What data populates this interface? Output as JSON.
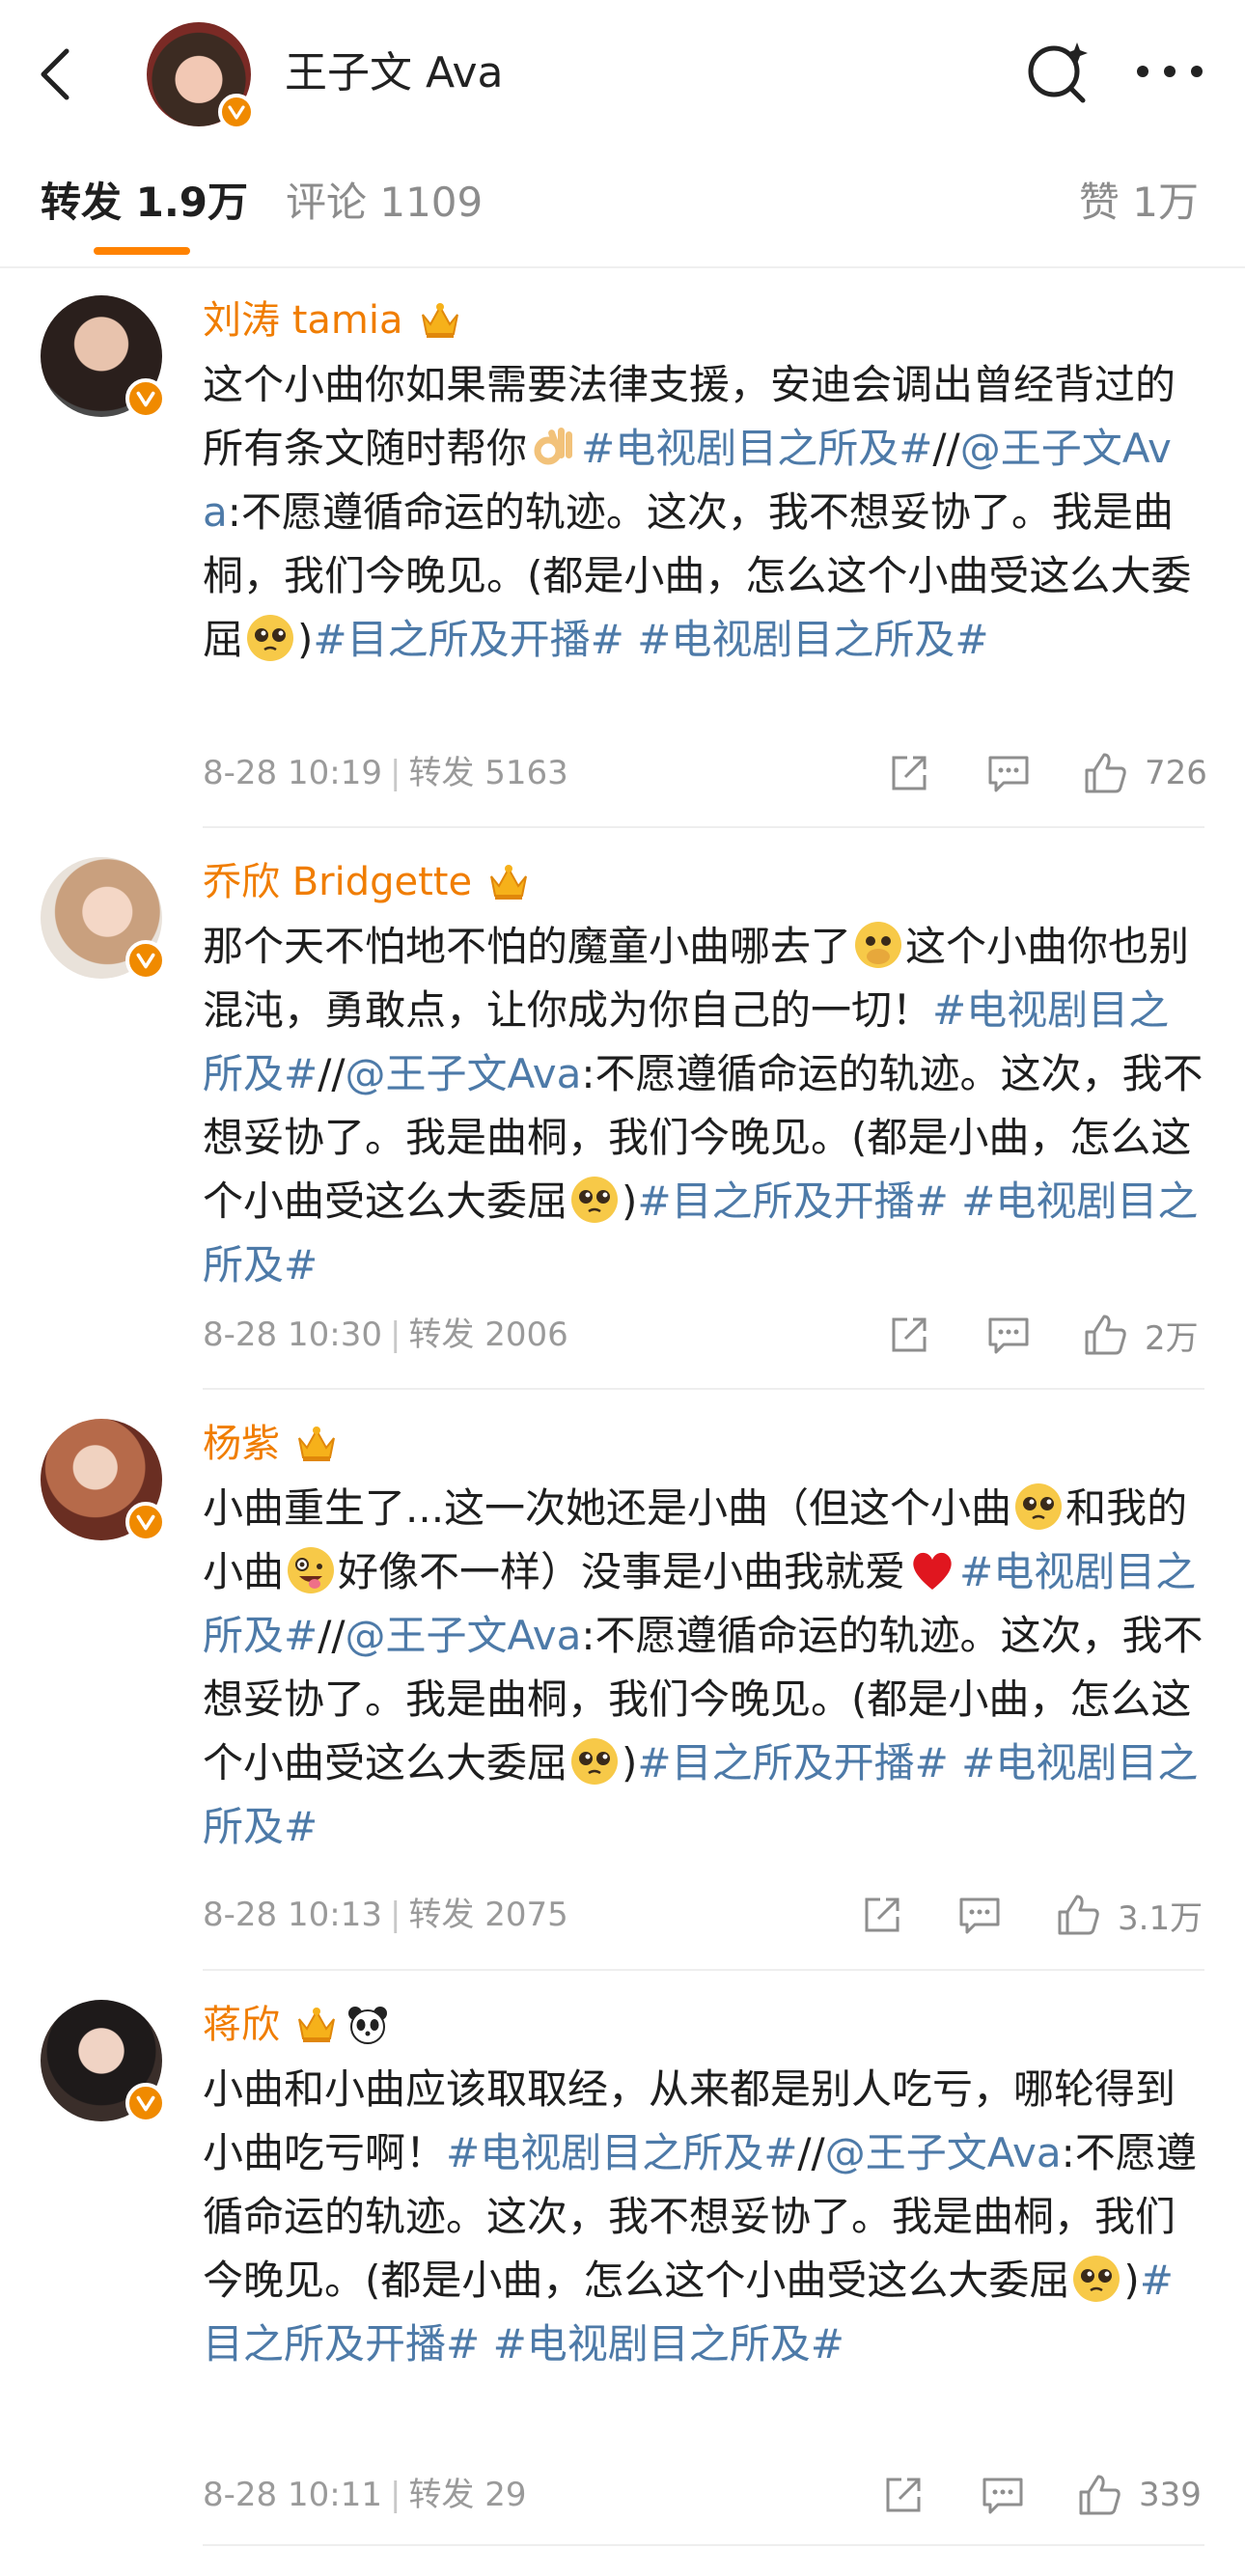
{
  "header": {
    "title": "王子文 Ava"
  },
  "tabs": {
    "repost_label": "转发 1.9万",
    "comments_label": "评论 1109",
    "likes_label": "赞 1万"
  },
  "posts": [
    {
      "author": "刘涛 tamia",
      "text_segments": [
        {
          "t": "这个小曲你如果需要法律支援，安迪会调出曾经背过的所有条文随时帮你",
          "c": "plain"
        },
        {
          "t": "#电视剧目之所及#",
          "c": "topic"
        },
        {
          "t": "//",
          "c": "plain"
        },
        {
          "t": "@王子文Ava",
          "c": "mention"
        },
        {
          "t": ":不愿遵循命运的轨迹。这次，我不想妥协了。我是曲桐，我们今晚见。(都是小曲，怎么这个小曲受这么大委屈",
          "c": "plain"
        },
        {
          "t": ")",
          "c": "plain"
        },
        {
          "t": "#目之所及开播#",
          "c": "topic"
        },
        {
          "t": " ",
          "c": "plain"
        },
        {
          "t": "#电视剧目之所及#",
          "c": "topic"
        }
      ],
      "time": "8-28 10:19",
      "repost": "转发 5163",
      "likes": "726"
    },
    {
      "author": "乔欣 Bridgette",
      "text_segments": [
        {
          "t": "那个天不怕地不怕的魔童小曲哪去了",
          "c": "plain"
        },
        {
          "t": "这个小曲你也别混沌，勇敢点，让你成为你自己的一切！",
          "c": "plain"
        },
        {
          "t": "#电视剧目之所及#",
          "c": "topic"
        },
        {
          "t": "//",
          "c": "plain"
        },
        {
          "t": "@王子文Ava",
          "c": "mention"
        },
        {
          "t": ":不愿遵循命运的轨迹。这次，我不想妥协了。我是曲桐，我们今晚见。(都是小曲，怎么这个小曲受这么大委屈",
          "c": "plain"
        },
        {
          "t": ")",
          "c": "plain"
        },
        {
          "t": "#目之所及开播#",
          "c": "topic"
        },
        {
          "t": " ",
          "c": "plain"
        },
        {
          "t": "#电视剧目之所及#",
          "c": "topic"
        }
      ],
      "time": "8-28 10:30",
      "repost": "转发 2006",
      "likes": "2万"
    },
    {
      "author": "杨紫",
      "text_segments": [
        {
          "t": "小曲重生了...这一次她还是小曲（但这个小曲",
          "c": "plain"
        },
        {
          "t": "和我的小曲",
          "c": "plain"
        },
        {
          "t": "好像不一样）没事是小曲我就爱",
          "c": "plain"
        },
        {
          "t": "#电视剧目之所及#",
          "c": "topic"
        },
        {
          "t": "//",
          "c": "plain"
        },
        {
          "t": "@王子文Ava",
          "c": "mention"
        },
        {
          "t": ":不愿遵循命运的轨迹。这次，我不想妥协了。我是曲桐，我们今晚见。(都是小曲，怎么这个小曲受这么大委屈",
          "c": "plain"
        },
        {
          "t": ")",
          "c": "plain"
        },
        {
          "t": "#目之所及开播#",
          "c": "topic"
        },
        {
          "t": " ",
          "c": "plain"
        },
        {
          "t": "#电视剧目之所及#",
          "c": "topic"
        }
      ],
      "time": "8-28 10:13",
      "repost": "转发 2075",
      "likes": "3.1万"
    },
    {
      "author": "蒋欣",
      "text_segments": [
        {
          "t": "小曲和小曲应该取取经，从来都是别人吃亏，哪轮得到小曲吃亏啊！",
          "c": "plain"
        },
        {
          "t": "#电视剧目之所及#",
          "c": "topic"
        },
        {
          "t": "//",
          "c": "plain"
        },
        {
          "t": "@王子文Ava",
          "c": "mention"
        },
        {
          "t": ":不愿遵循命运的轨迹。这次，我不想妥协了。我是曲桐，我们今晚见。(都是小曲，怎么这个小曲受这么大委屈",
          "c": "plain"
        },
        {
          "t": ")",
          "c": "plain"
        },
        {
          "t": "#目之所及开播#",
          "c": "topic"
        },
        {
          "t": " ",
          "c": "plain"
        },
        {
          "t": "#电视剧目之所及#",
          "c": "topic"
        }
      ],
      "time": "8-28 10:11",
      "repost": "转发 29",
      "likes": "339"
    }
  ],
  "colors": {
    "accent_orange": "#ff8200",
    "author_orange": "#f07d00",
    "link_blue": "#4d7aa8",
    "meta_gray": "#9a9a9a",
    "verified_badge": "#f08a00"
  },
  "icons": {
    "back": "chevron-left-icon",
    "search": "search-sparkle-icon",
    "more": "more-dots-icon",
    "crown": "crown-icon",
    "panda": "panda-icon",
    "repost": "share-icon",
    "comment": "comment-icon",
    "like": "thumbs-up-icon",
    "verified": "verified-v-icon"
  }
}
